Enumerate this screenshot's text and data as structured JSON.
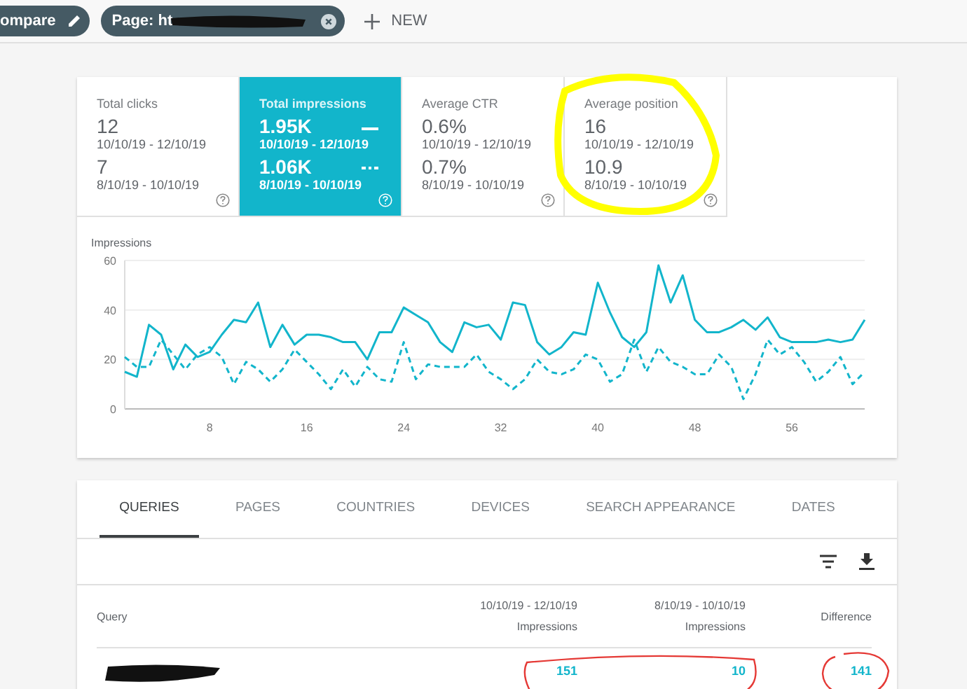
{
  "filter_bar": {
    "chips": [
      {
        "label": "ompare",
        "kind": "compare",
        "redacted": false
      },
      {
        "label": "Page: ht",
        "kind": "page",
        "redacted": true
      }
    ],
    "new_button": "NEW"
  },
  "metrics": [
    {
      "title": "Total clicks",
      "selected": false,
      "highlighted": false,
      "current": "12",
      "current_range": "10/10/19 - 12/10/19",
      "previous": "7",
      "previous_range": "8/10/19 - 10/10/19"
    },
    {
      "title": "Total impressions",
      "selected": true,
      "highlighted": false,
      "current": "1.95K",
      "current_range": "10/10/19 - 12/10/19",
      "previous": "1.06K",
      "previous_range": "8/10/19 - 10/10/19"
    },
    {
      "title": "Average CTR",
      "selected": false,
      "highlighted": false,
      "current": "0.6%",
      "current_range": "10/10/19 - 12/10/19",
      "previous": "0.7%",
      "previous_range": "8/10/19 - 10/10/19"
    },
    {
      "title": "Average position",
      "selected": false,
      "highlighted": true,
      "current": "16",
      "current_range": "10/10/19 - 12/10/19",
      "previous": "10.9",
      "previous_range": "8/10/19 - 10/10/19"
    }
  ],
  "chart": {
    "chart_data": {
      "type": "line",
      "ylabel": "Impressions",
      "ylim": [
        0,
        60
      ],
      "yticks": [
        0,
        20,
        40,
        60
      ],
      "xlim": [
        1,
        62
      ],
      "xticks": [
        8,
        16,
        24,
        32,
        40,
        48,
        56
      ],
      "x": [
        1,
        2,
        3,
        4,
        5,
        6,
        7,
        8,
        9,
        10,
        11,
        12,
        13,
        14,
        15,
        16,
        17,
        18,
        19,
        20,
        21,
        22,
        23,
        24,
        25,
        26,
        27,
        28,
        29,
        30,
        31,
        32,
        33,
        34,
        35,
        36,
        37,
        38,
        39,
        40,
        41,
        42,
        43,
        44,
        45,
        46,
        47,
        48,
        49,
        50,
        51,
        52,
        53,
        54,
        55,
        56,
        57,
        58,
        59,
        60,
        61,
        62
      ],
      "series": [
        {
          "color": "#12b5cb",
          "line_style": "solid",
          "values": [
            15,
            13,
            34,
            30,
            16,
            26,
            21,
            23,
            30,
            36,
            35,
            43,
            25,
            34,
            26,
            30,
            30,
            29,
            27,
            27,
            20,
            31,
            31,
            41,
            38,
            35,
            27,
            23,
            35,
            33,
            34,
            28,
            43,
            42,
            27,
            22,
            25,
            31,
            30,
            51,
            39,
            29,
            25,
            31,
            58,
            43,
            54,
            36,
            31,
            31,
            33,
            36,
            32,
            37,
            29,
            27,
            27,
            27,
            28,
            27,
            28,
            36
          ]
        },
        {
          "color": "#12b5cb",
          "line_style": "dashed",
          "values": [
            21,
            17,
            17,
            28,
            22,
            16,
            22,
            25,
            21,
            10,
            19,
            16,
            11,
            16,
            24,
            19,
            14,
            8,
            16,
            9,
            17,
            12,
            11,
            27,
            12,
            18,
            17,
            17,
            17,
            22,
            15,
            12,
            8,
            12,
            20,
            15,
            14,
            16,
            22,
            20,
            11,
            14,
            28,
            15,
            25,
            19,
            17,
            14,
            14,
            22,
            17,
            4,
            14,
            28,
            22,
            25,
            19,
            11,
            15,
            21,
            10,
            15
          ]
        }
      ]
    }
  },
  "tabs": [
    {
      "label": "QUERIES",
      "selected": true
    },
    {
      "label": "PAGES",
      "selected": false
    },
    {
      "label": "COUNTRIES",
      "selected": false
    },
    {
      "label": "DEVICES",
      "selected": false
    },
    {
      "label": "SEARCH APPEARANCE",
      "selected": false
    },
    {
      "label": "DATES",
      "selected": false
    }
  ],
  "table": {
    "columns": [
      {
        "label": "Query"
      },
      {
        "range": "10/10/19 - 12/10/19",
        "label": "Impressions"
      },
      {
        "range": "8/10/19 - 10/10/19",
        "label": "Impressions"
      },
      {
        "label": "Difference"
      }
    ],
    "rows": [
      {
        "query_redacted": true,
        "current": "151",
        "previous": "10",
        "difference": "141",
        "circled": true
      }
    ]
  }
}
